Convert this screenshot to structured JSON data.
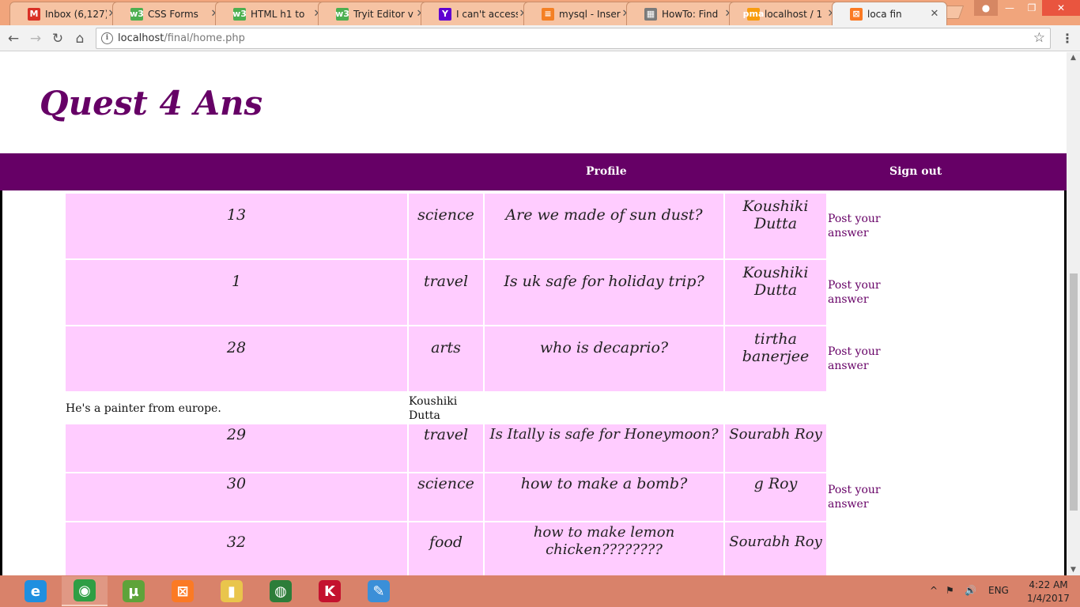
{
  "browser": {
    "tabs": [
      {
        "title": "Inbox (6,127)",
        "icon": "gmail-icon",
        "icon_glyph": "M",
        "icon_color": "#d93025"
      },
      {
        "title": "CSS Forms",
        "icon": "w3schools-icon",
        "icon_glyph": "w3",
        "icon_color": "#4caf50"
      },
      {
        "title": "HTML h1 to",
        "icon": "w3schools-icon",
        "icon_glyph": "w3",
        "icon_color": "#4caf50"
      },
      {
        "title": "Tryit Editor v",
        "icon": "w3schools-icon",
        "icon_glyph": "w3",
        "icon_color": "#4caf50"
      },
      {
        "title": "I can't access",
        "icon": "yahoo-icon",
        "icon_glyph": "Y",
        "icon_color": "#5f01d1"
      },
      {
        "title": "mysql - Inser",
        "icon": "stackoverflow-icon",
        "icon_glyph": "≡",
        "icon_color": "#f48024"
      },
      {
        "title": "HowTo: Find",
        "icon": "grid-icon",
        "icon_glyph": "▦",
        "icon_color": "#7a7a7a"
      },
      {
        "title": "localhost / 1",
        "icon": "phpmyadmin-icon",
        "icon_glyph": "pma",
        "icon_color": "#f89c0e"
      },
      {
        "title": "loca fin",
        "icon": "xampp-icon",
        "icon_glyph": "⊠",
        "icon_color": "#fb7a24",
        "active": true
      }
    ],
    "url_host": "localhost",
    "url_path": "/final/home.php"
  },
  "page": {
    "site_title": "Quest 4 Ans",
    "nav": {
      "profile": "Profile",
      "sign_out": "Sign out"
    },
    "rows": [
      {
        "id": "13",
        "category": "science",
        "question": "Are we made of sun dust?",
        "author": "Koushiki Dutta",
        "link": "Post your answer"
      },
      {
        "id": "1",
        "category": "travel",
        "question": "Is uk safe for holiday trip?",
        "author": "Koushiki Dutta",
        "link": "Post your answer"
      },
      {
        "id": "28",
        "category": "arts",
        "question": "who is decaprio?",
        "author": "tirtha banerjee",
        "link": "Post your answer"
      },
      {
        "id": "29",
        "category": "travel",
        "question": "Is Itally is safe for Honeymoon?",
        "author": "Sourabh Roy",
        "link": ""
      },
      {
        "id": "30",
        "category": "science",
        "question": "how to make a bomb?",
        "author": "g Roy",
        "link": "Post your answer"
      },
      {
        "id": "32",
        "category": "food",
        "question": "how to make lemon chicken????????",
        "author": "Sourabh Roy",
        "link": ""
      }
    ],
    "answer": {
      "text": "He's a painter from europe.",
      "author": "Koushiki Dutta"
    }
  },
  "taskbar": {
    "apps": [
      {
        "name": "internet-explorer-icon",
        "glyph": "e",
        "color": "#1f8fe0"
      },
      {
        "name": "chrome-icon",
        "glyph": "◉",
        "color": "#2f9e44",
        "open": true
      },
      {
        "name": "utorrent-icon",
        "glyph": "µ",
        "color": "#5ea33a"
      },
      {
        "name": "xampp-icon",
        "glyph": "⊠",
        "color": "#fb7a24"
      },
      {
        "name": "file-explorer-icon",
        "glyph": "▮",
        "color": "#e9c54c"
      },
      {
        "name": "network-globe-icon",
        "glyph": "◍",
        "color": "#2d7d3a"
      },
      {
        "name": "kaspersky-icon",
        "glyph": "K",
        "color": "#c4122f"
      },
      {
        "name": "paint-icon",
        "glyph": "✎",
        "color": "#3b8fd8"
      }
    ],
    "language": "ENG",
    "time": "4:22 AM",
    "date": "1/4/2017"
  }
}
